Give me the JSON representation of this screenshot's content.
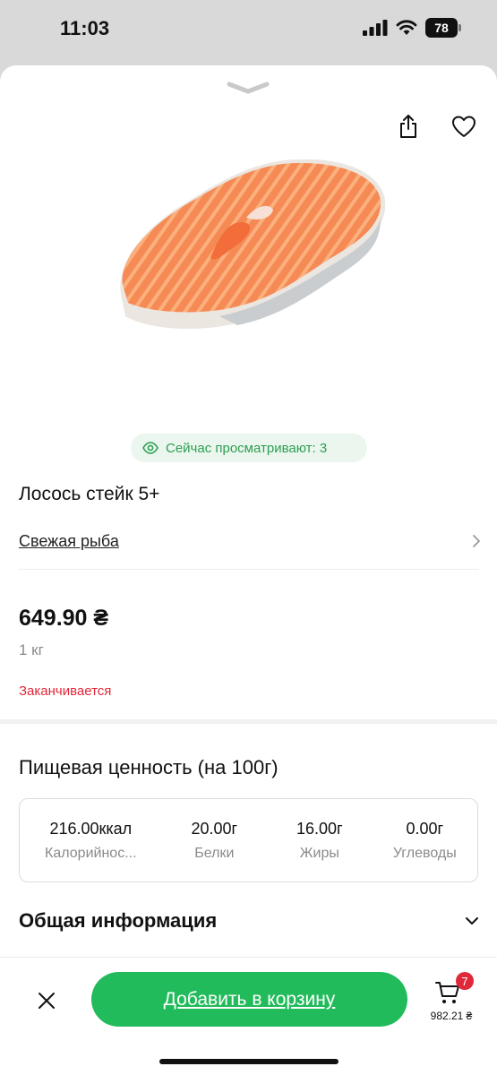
{
  "status_bar": {
    "time": "11:03",
    "battery": "78",
    "icons": [
      "signal-icon",
      "wifi-icon",
      "battery-icon"
    ]
  },
  "header": {
    "icons": [
      "chevron-down-icon",
      "share-icon",
      "heart-icon"
    ]
  },
  "product": {
    "image": "salmon-steak-image",
    "viewing_now": "Сейчас просматривают: 3",
    "title": "Лосось стейк 5+",
    "category": "Свежая рыба",
    "price": "649.90 ₴",
    "unit": "1 кг",
    "stock_status": "Заканчивается"
  },
  "nutrition": {
    "title": "Пищевая ценность (на 100г)",
    "items": [
      {
        "value": "216.00ккал",
        "label": "Калорийнос..."
      },
      {
        "value": "20.00г",
        "label": "Белки"
      },
      {
        "value": "16.00г",
        "label": "Жиры"
      },
      {
        "value": "0.00г",
        "label": "Углеводы"
      }
    ]
  },
  "general_info": {
    "title": "Общая информация"
  },
  "bottom_bar": {
    "add_to_cart": "Добавить в корзину",
    "cart_count": "7",
    "cart_total": "982.21 ₴"
  },
  "colors": {
    "accent": "#22BB5B",
    "badge_bg": "#EAF6EE",
    "badge_text": "#2F9E52",
    "warning": "#E0283A",
    "muted": "#8A8A8A",
    "screen_dim": "#D9D9D9"
  }
}
